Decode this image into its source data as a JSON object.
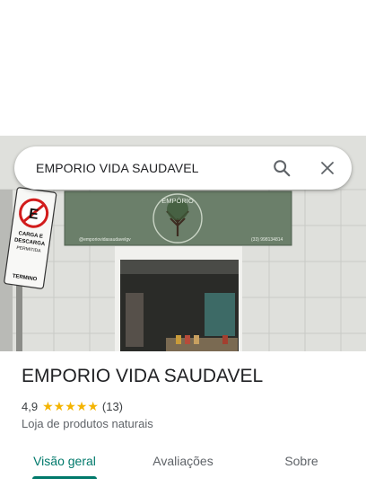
{
  "search": {
    "query": "EMPORIO VIDA SAUDAVEL",
    "search_icon": "search-icon",
    "close_icon": "close-icon"
  },
  "photo": {
    "sign_title": "EMPÓRIO",
    "sign_handle": "@emporiovidasaudavelgv",
    "sign_phone": "(33) 998134814",
    "street_sign_lines": [
      "CARGA E",
      "DESCARGA",
      "PERMITIDA",
      "TERMINO"
    ]
  },
  "place": {
    "name": "EMPORIO VIDA SAUDAVEL",
    "rating": "4,9",
    "stars": 5,
    "review_count": "(13)",
    "category": "Loja de produtos naturais",
    "star_color": "#f4b400"
  },
  "tabs": [
    {
      "label": "Visão geral",
      "active": true
    },
    {
      "label": "Avaliações",
      "active": false
    },
    {
      "label": "Sobre",
      "active": false
    }
  ],
  "accent": "#00796b"
}
